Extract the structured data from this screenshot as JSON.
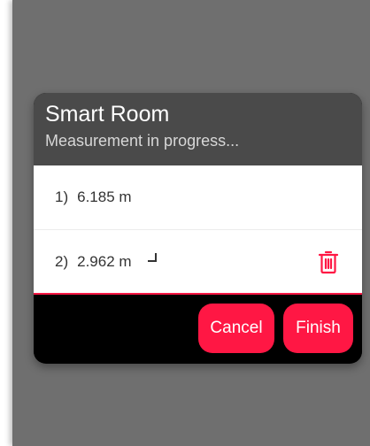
{
  "dialog": {
    "title": "Smart Room",
    "subtitle": "Measurement in progress...",
    "measurements": [
      {
        "index": "1)",
        "value": "6.185 m",
        "corner_mark": false,
        "deletable": false
      },
      {
        "index": "2)",
        "value": "2.962 m",
        "corner_mark": true,
        "deletable": true,
        "icon": "trash-icon"
      }
    ],
    "buttons": {
      "cancel": "Cancel",
      "finish": "Finish"
    }
  },
  "colors": {
    "accent": "#ff1744",
    "backdrop": "#6f6f6f",
    "header": "#4a4a4a"
  }
}
